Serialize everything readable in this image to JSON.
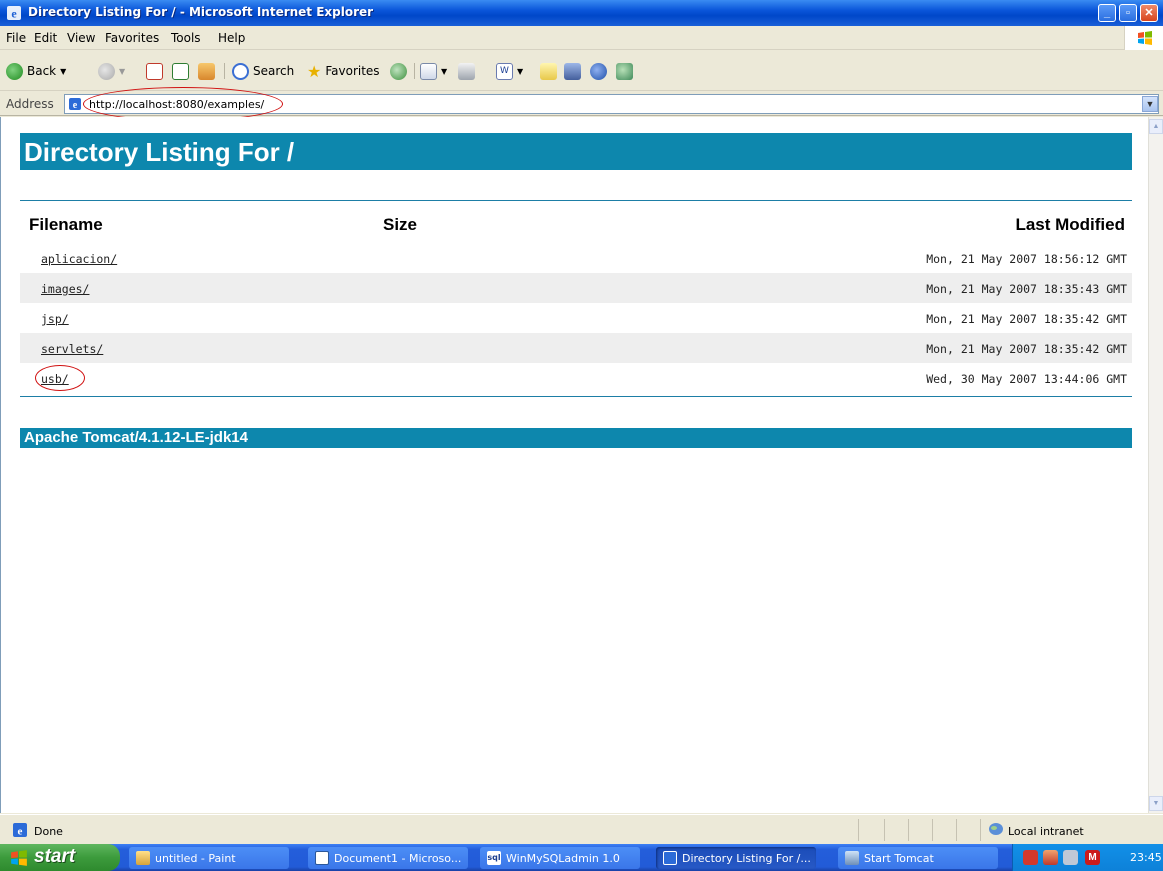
{
  "window": {
    "title": "Directory Listing For / - Microsoft Internet Explorer"
  },
  "menu": [
    "File",
    "Edit",
    "View",
    "Favorites",
    "Tools",
    "Help"
  ],
  "toolbar": {
    "back_label": "Back",
    "search_label": "Search",
    "favorites_label": "Favorites"
  },
  "address": {
    "label": "Address",
    "url": "http://localhost:8080/examples/"
  },
  "page": {
    "heading": "Directory Listing For /",
    "columns": {
      "filename": "Filename",
      "size": "Size",
      "modified": "Last Modified"
    },
    "rows": [
      {
        "name": "aplicacion/",
        "modified": "Mon, 21 May 2007 18:56:12 GMT"
      },
      {
        "name": "images/",
        "modified": "Mon, 21 May 2007 18:35:43 GMT"
      },
      {
        "name": "jsp/",
        "modified": "Mon, 21 May 2007 18:35:42 GMT"
      },
      {
        "name": "servlets/",
        "modified": "Mon, 21 May 2007 18:35:42 GMT"
      },
      {
        "name": "usb/",
        "modified": "Wed, 30 May 2007 13:44:06 GMT"
      }
    ],
    "footer": "Apache Tomcat/4.1.12-LE-jdk14",
    "banner_color": "#0d87ad"
  },
  "status": {
    "text": "Done",
    "zone": "Local intranet"
  },
  "taskbar": {
    "start_label": "start",
    "tasks": [
      {
        "label": "untitled - Paint",
        "icon": "paint-icon",
        "active": false
      },
      {
        "label": "Document1 - Microso...",
        "icon": "word-icon",
        "active": false
      },
      {
        "label": "WinMySQLadmin 1.0",
        "icon": "sql-icon",
        "active": false
      },
      {
        "label": "Directory Listing For /...",
        "icon": "ie-icon",
        "active": true
      },
      {
        "label": "Start Tomcat",
        "icon": "tomcat-icon",
        "active": false
      }
    ],
    "clock": "23:45"
  }
}
